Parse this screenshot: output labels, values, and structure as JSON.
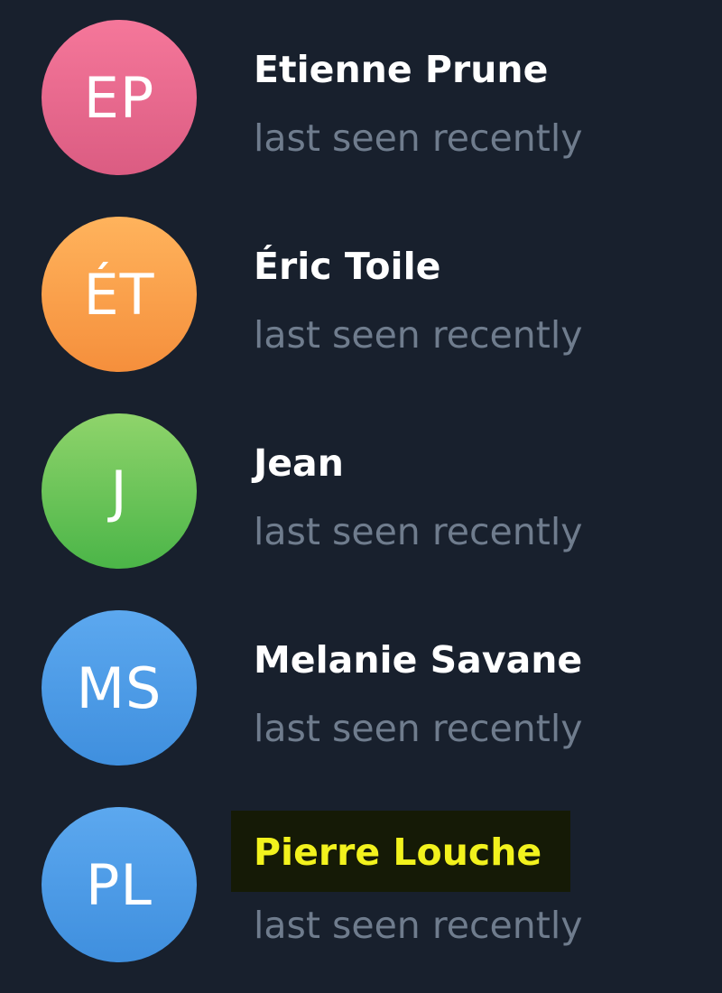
{
  "contacts": [
    {
      "initials": "EP",
      "name": "Etienne Prune",
      "status": "last seen recently",
      "avatar_color_top": "#f5779a",
      "avatar_color_bottom": "#db5c82"
    },
    {
      "initials": "ÉT",
      "name": "Éric Toile",
      "status": "last seen recently",
      "avatar_color_top": "#ffb35c",
      "avatar_color_bottom": "#f58f3c"
    },
    {
      "initials": "J",
      "name": "Jean",
      "status": "last seen recently",
      "avatar_color_top": "#8fd46b",
      "avatar_color_bottom": "#4bb548"
    },
    {
      "initials": "MS",
      "name": "Melanie Savane",
      "status": "last seen recently",
      "avatar_color_top": "#5ca8ef",
      "avatar_color_bottom": "#3f8fde"
    },
    {
      "initials": "PL",
      "name": "Pierre Louche",
      "status": "last seen recently",
      "avatar_color_top": "#5ca8ef",
      "avatar_color_bottom": "#3f8fde",
      "highlighted": true
    }
  ],
  "colors": {
    "background": "#18202d",
    "name_text": "#ffffff",
    "status_text": "#6f7c8d",
    "highlight_text": "#f2f21d",
    "highlight_background": "#151a06"
  }
}
